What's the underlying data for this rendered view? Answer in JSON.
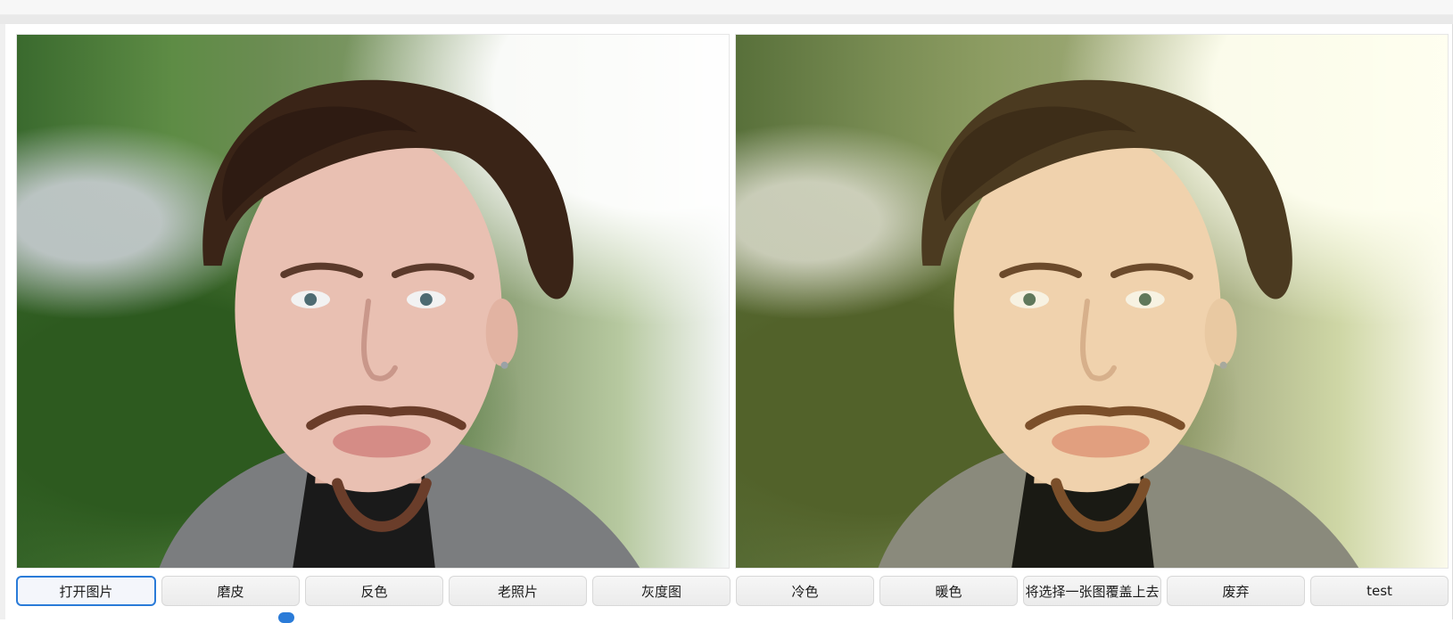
{
  "app": {
    "title": ""
  },
  "images": {
    "left": {
      "label": ""
    },
    "right": {
      "label": ""
    }
  },
  "toolbar": {
    "buttons": [
      {
        "label": "打开图片"
      },
      {
        "label": "磨皮"
      },
      {
        "label": "反色"
      },
      {
        "label": "老照片"
      },
      {
        "label": "灰度图"
      },
      {
        "label": "冷色"
      },
      {
        "label": "暖色"
      },
      {
        "label": "将选择一张图覆盖上去"
      },
      {
        "label": "废弃"
      },
      {
        "label": "test"
      }
    ],
    "focused_button": "打开图片",
    "highlighted_button": "暖色"
  },
  "colors": {
    "accent": "#2a7bd8",
    "highlight": "#e11d48"
  }
}
